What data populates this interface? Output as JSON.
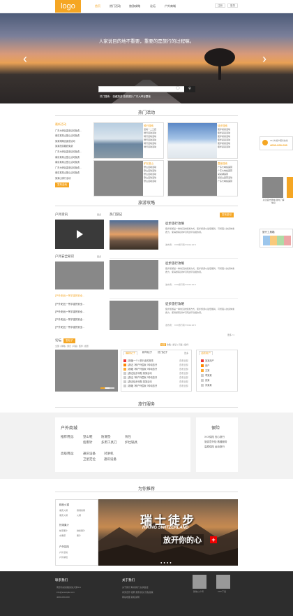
{
  "header": {
    "logo": "logo",
    "nav": [
      "首页",
      "热门活动",
      "旅游攻略",
      "论坛",
      "户外商城"
    ],
    "login": "注册",
    "register": "登录"
  },
  "banner": {
    "slogan": "人家说目的地不重要，重要的是旅行的过程嘛。",
    "search_placeholder": "",
    "hot_tags": "热门搜索：  西藏旅游   旅游团队   广东大峡谷露营"
  },
  "sections": {
    "hot": "热门活动",
    "strategy": "旅游攻略",
    "service": "旅行服务",
    "recommend": "为你推荐"
  },
  "hot": {
    "list_title": "最新活动",
    "list": [
      "广东大峡谷露营活动免费…",
      "南京某某山登山活动免费",
      "某某湖湖边露营活动",
      "某某旅游路线免费",
      "广东大峡谷露营活动免费…",
      "南京某某山登山活动免费",
      "南京某某山登山活动免费",
      "广东大峡谷露营活动免费…",
      "南京某某山登山活动免费",
      "某某山骑行活动"
    ],
    "list_btn": "发布活动",
    "cards": [
      {
        "title": "骑行搜索",
        "items": [
          "活动一二三四",
          "骑行活动活动",
          "骑行活动活动",
          "骑行活动活动",
          "骑行活动活动",
          "骑行活动活动"
        ]
      },
      {
        "title": "徒步搜索",
        "items": [
          "徒步某某活动",
          "徒步某某活动",
          "徒步某某活动",
          "徒步某某活动",
          "徒步某某活动",
          "徒步某某活动"
        ]
      },
      {
        "title": "驴友登山",
        "items": [
          "登山活动活动",
          "登山活动活动",
          "登山活动活动",
          "登山活动活动",
          "登山活动活动"
        ]
      },
      {
        "title": "露营搜索",
        "items": [
          "广东大峡谷露营",
          "广东大峡谷露营",
          "某某湖露营",
          "某某山露营活动",
          "广东大峡谷露营"
        ]
      }
    ]
  },
  "strategy": {
    "news_title": "户外资讯",
    "news_more": "更多",
    "safety_title": "户外安全知识",
    "safety_more": "更多",
    "tips_title": "热门游记",
    "publish": "发布游记",
    "safety_list": [
      "[户外安全]一所宇宙的安全…",
      "[户外安全]一所宇宙的安全…",
      "[户外安全]一所宇宙的安全…",
      "[户外安全]一所宇宙的安全…"
    ],
    "items": [
      {
        "title": "徒步旅行攻略",
        "desc": "徒步旅游是一种常见的旅游方式，徒步旅游以最低能耗，可增强人的身体素质力，使得旅客身体与周边环境相协调。",
        "meta": "发布者： XXX旅行者    5%/14:20  5"
      },
      {
        "title": "徒步旅行攻略",
        "desc": "徒步旅游是一种常见的旅游方式，徒步旅游以最低能耗，可增强人的身体素质力，使得旅客身体与周边环境相协调。",
        "meta": "发布者： XXX旅行者    5%/14:20  5"
      },
      {
        "title": "徒步旅行攻略",
        "desc": "徒步旅游是一种常见的旅游方式，徒步旅游以最低能耗，可增强人的身体素质力，使得旅客身体与周边环境相协调。",
        "meta": "发布者： XXX旅行者    5%/14:20  5"
      }
    ],
    "more_link": "更多 >>"
  },
  "forum": {
    "title": "论坛",
    "tag": "发帖子",
    "tabs": [
      "最新帖子",
      "精华帖子",
      "热门帖子"
    ],
    "more": "更多",
    "cats": [
      "全部",
      "攻略",
      "游记",
      "问答",
      "结伴",
      "摄影"
    ],
    "rows": [
      "[攻略]一个人的行走的故事",
      "[游记]  7种户外围玩  7种动态开",
      "[攻略]  7种户外围玩  7种动态开",
      "[游记]徒步深险 某某活动",
      "[游记]  7种户外围玩  7种动态开",
      "[游记]徒步深险 某某活动",
      "[攻略]  7种户外围玩  7种动态开",
      "[游记]徒步深险 某某活动"
    ],
    "row_time": "查看全部",
    "users_title": "活跃用户",
    "users": [
      "某某用户",
      "用户",
      "王某",
      "李某某",
      "张某",
      "刘某某",
      "用户名"
    ]
  },
  "service": {
    "mall_title": "户外商城",
    "rec_label": "推荐用品:",
    "rec_items": [
      "登山鞋",
      "防潮垫",
      "背包",
      "指南针",
      "多用工具刀",
      "炉灶锅具"
    ],
    "adv_label": "高级用品:",
    "adv_items": [
      "通讯设备",
      "对讲机",
      "卫星定位",
      "通讯设备"
    ],
    "ins_title": "保险",
    "ins_items": [
      "XXX保险 安心旅行",
      "旅游意外险 救援服务",
      "高原保险 运动旅行"
    ]
  },
  "recommend": {
    "list": [
      {
        "h": "精品火锅",
        "items": [
          "重庆火锅",
          "麻辣香锅",
          "重庆火锅",
          "火锅"
        ]
      },
      {
        "h": "热带果汁",
        "items": [
          "热带果汁",
          "鲜榨果汁",
          "水果捞",
          "果汁"
        ]
      },
      {
        "h": "户外探险",
        "items": [
          "户外活动",
          "户外探险"
        ]
      }
    ],
    "banner_cn": "瑞士徒步",
    "banner_en": "HIKING SWITZERLAND",
    "banner_sub": "放开你的心"
  },
  "footer": {
    "contact_title": "联系我们",
    "contact": [
      "南京市某某路某某大厦801",
      "info@example.com",
      "4000-000-000"
    ],
    "about_title": "关于我们",
    "about": [
      "关于我们  联系我们  友情链接",
      "商务合作  招聘  服务协议  隐私政策",
      "网站地图  版权说明"
    ],
    "qr1": "微信公众号",
    "qr2": "APP下载"
  },
  "float": {
    "phone_title": "24小时客户服务热线",
    "phone": "4000-000-000",
    "qr_text": "关注官方微信 随时了解信息",
    "weather_title": "旅行工具箱"
  },
  "colors": {
    "accent": "#f5a623",
    "dark": "#2d2d2d"
  }
}
